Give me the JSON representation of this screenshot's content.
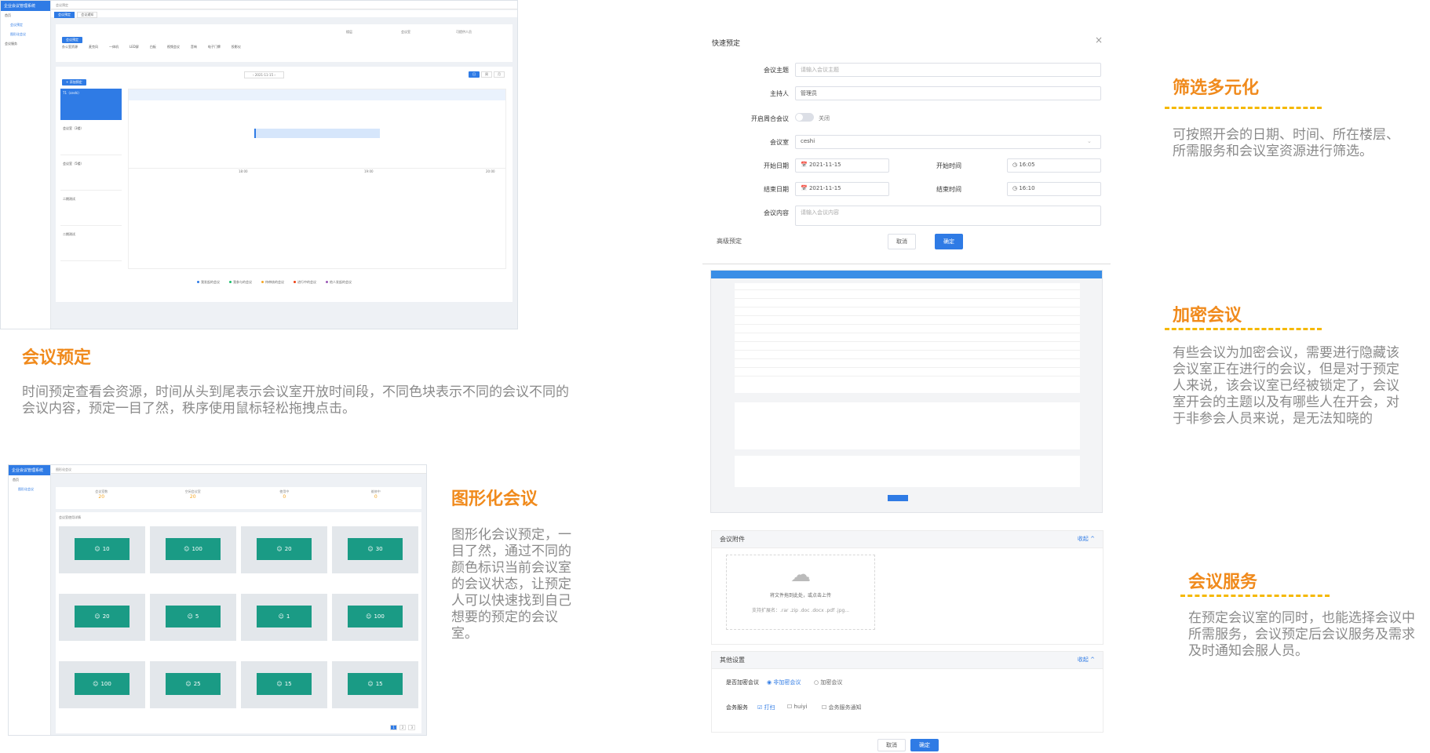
{
  "app": {
    "name": "企业会议管理系统"
  },
  "screenshot1": {
    "sidebar": [
      "首页"
    ],
    "tabs": [
      "会议预定",
      "会议通知"
    ],
    "filters": {
      "floor_label": "楼层",
      "room_label": "会议室",
      "service_label": "可提供人员"
    },
    "services": [
      "办公室资源",
      "麦克风",
      "一体机",
      "LED屏",
      "白板",
      "视频会议",
      "音响",
      "电子门牌",
      "投影仪"
    ],
    "add_btn": "+ 添加预定",
    "date_value": "2021-11-15",
    "view_buttons": [
      "日",
      "周",
      "月"
    ],
    "rooms": [
      "T1（ceshi）",
      "会议室（3楼）",
      "会议室（5楼）",
      "二期测试",
      "二期测试"
    ],
    "times": [
      "18:00",
      "19:00",
      "20:00"
    ],
    "legend": [
      "我发起的会议",
      "我参与的会议",
      "待审核的会议",
      "进行中的会议",
      "他人发起的会议"
    ]
  },
  "section1": {
    "title": "会议预定",
    "desc": "时间预定查看会资源，时间从头到尾表示会议室开放时间段，不同色块表示不同的会议不同的会议内容，预定一目了然，秩序使用鼠标轻松拖拽点击。"
  },
  "screenshot2": {
    "stats": [
      {
        "label": "会议室数",
        "value": "20"
      },
      {
        "label": "空闲会议室",
        "value": "20"
      },
      {
        "label": "使用中",
        "value": "0"
      },
      {
        "label": "维修中",
        "value": "0"
      }
    ],
    "list_title": "会议室使用详情",
    "capacities": [
      "10",
      "100",
      "20",
      "30",
      "20",
      "5",
      "1",
      "100",
      "100",
      "25",
      "15",
      "15"
    ],
    "pager": [
      "1",
      "2",
      "3"
    ]
  },
  "section2": {
    "title": "图形化会议",
    "desc": "图形化会议预定，一目了然，通过不同的颜色标识当前会议室的会议状态，让预定人可以快速找到自己想要的预定的会议室。"
  },
  "dialog": {
    "title": "快速预定",
    "close": "×",
    "subject_label": "会议主题",
    "subject_placeholder": "请输入会议主题",
    "host_label": "主持人",
    "host_value": "管理员",
    "recurring_label": "开启周合会议",
    "recurring_state": "关闭",
    "room_label": "会议室",
    "room_value": "ceshi",
    "start_date_label": "开始日期",
    "start_date": "2021-11-15",
    "start_time_label": "开始时间",
    "start_time": "16:05",
    "end_date_label": "结束日期",
    "end_date": "2021-11-15",
    "end_time_label": "结束时间",
    "end_time": "16:10",
    "content_label": "会议内容",
    "content_placeholder": "请输入会议内容",
    "advanced": "高级预定",
    "cancel": "取消",
    "confirm": "确定"
  },
  "attachment": {
    "title": "会议附件",
    "collapse": "收起 ^",
    "upload_text": "将文件拖到此处，或点击上传",
    "formats": "支持扩展名：.rar .zip .doc .docx .pdf .jpg..."
  },
  "other": {
    "title": "其他设置",
    "collapse": "收起 ^",
    "encrypt_label": "是否加密会议",
    "encrypt_options": [
      "非加密会议",
      "加密会议"
    ],
    "service_label": "会务服务",
    "service_options": [
      "打扫",
      "huiyi",
      "会务服务通知"
    ],
    "cancel": "取消",
    "confirm": "确定"
  },
  "section3": {
    "title": "筛选多元化",
    "desc": "可按照开会的日期、时间、所在楼层、所需服务和会议室资源进行筛选。"
  },
  "section4": {
    "title": "加密会议",
    "desc": "有些会议为加密会议，需要进行隐藏该会议室正在进行的会议，但是对于预定人来说，该会议室已经被锁定了，会议室开会的主题以及有哪些人在开会，对于非参会人员来说，是无法知晓的"
  },
  "section5": {
    "title": "会议服务",
    "desc": "在预定会议室的同时，也能选择会议中所需服务，会议预定后会议服务及需求及时通知会服人员。"
  }
}
